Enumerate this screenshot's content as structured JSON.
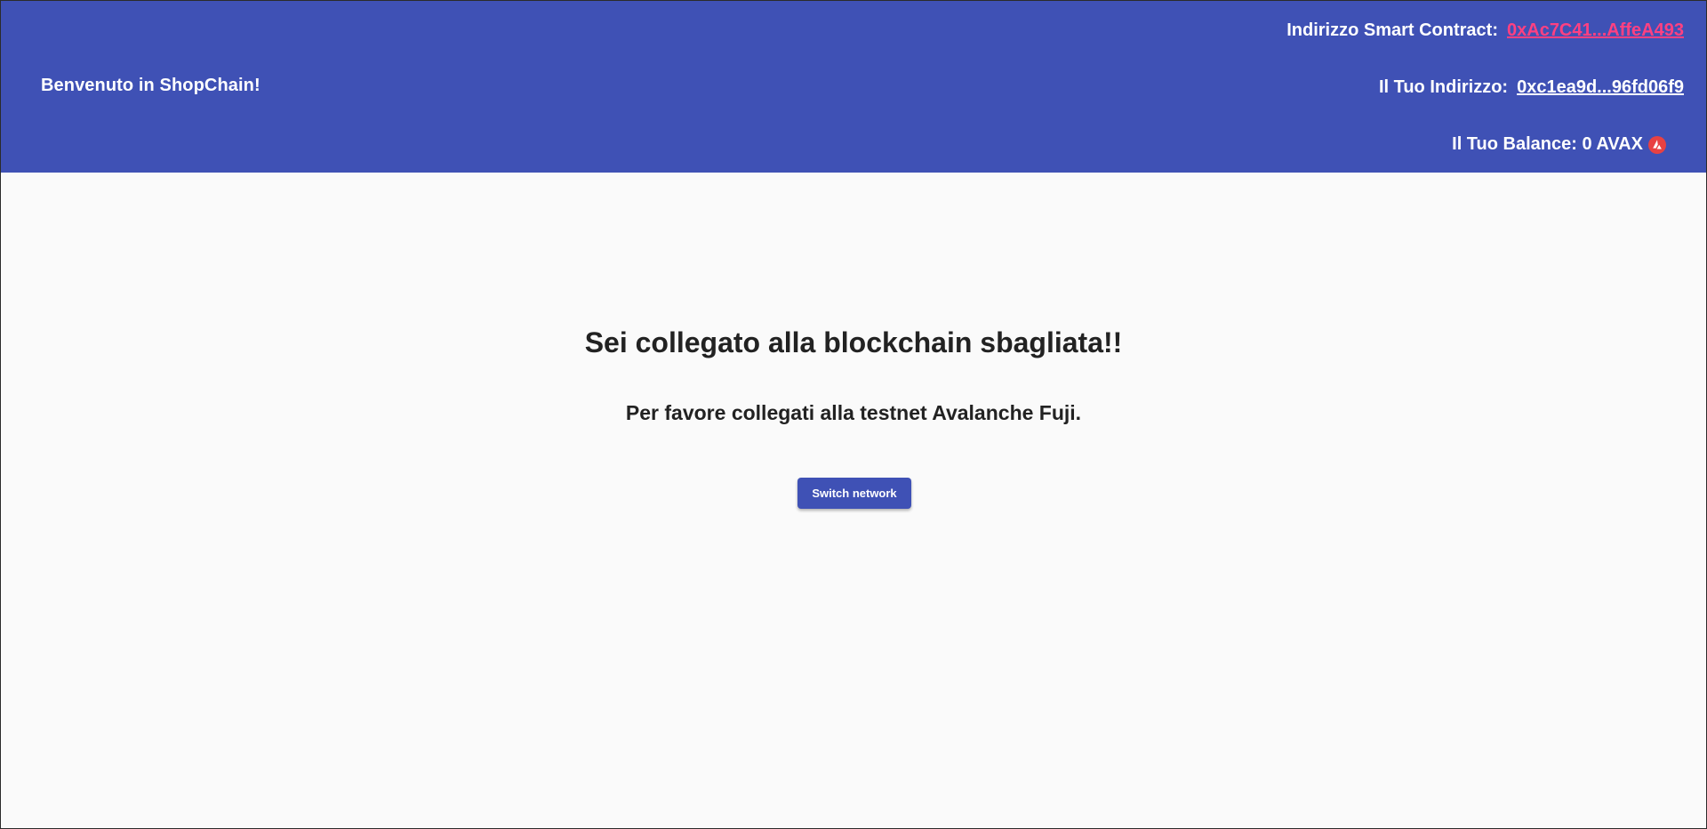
{
  "header": {
    "welcome": "Benvenuto in ShopChain!",
    "contract_label": "Indirizzo Smart Contract:",
    "contract_address": "0xAc7C41...AffeA493",
    "address_label": "Il Tuo Indirizzo:",
    "user_address": "0xc1ea9d...96fd06f9",
    "balance_text": "Il Tuo Balance: 0 AVAX",
    "balance_icon": "avalanche-icon"
  },
  "main": {
    "title": "Sei collegato alla blockchain sbagliata!!",
    "subtitle": "Per favore collegati alla testnet Avalanche Fuji.",
    "switch_button": "Switch network"
  },
  "colors": {
    "primary": "#3f51b5",
    "accent": "#ff4081",
    "background": "#fafafa",
    "avalanche_red": "#e84142"
  }
}
